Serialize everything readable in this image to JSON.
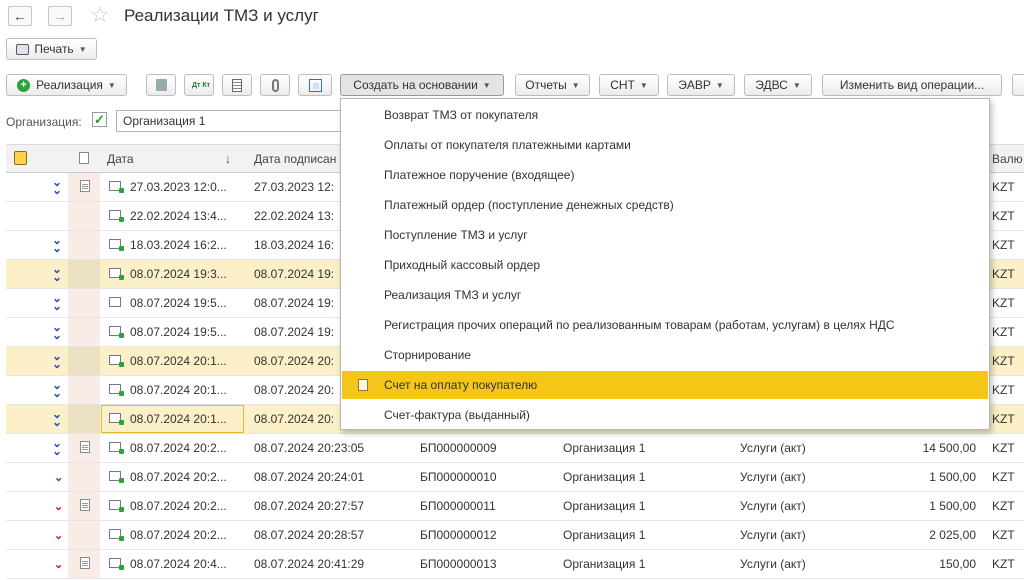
{
  "header": {
    "title": "Реализации ТМЗ и услуг",
    "back_icon": "←",
    "forward_icon": "→",
    "star_icon": "☆"
  },
  "toolbar1": {
    "print_label": "Печать"
  },
  "toolbar2": {
    "realization_label": "Реализация",
    "dt_kt_label": "Дт Кт",
    "create_based_label": "Создать на основании",
    "reports_label": "Отчеты",
    "snt_label": "СНТ",
    "eavr_label": "ЭАВР",
    "edvs_label": "ЭДВС",
    "change_op_label": "Изменить вид операции..."
  },
  "filter": {
    "org_label": "Организация:",
    "org_value": "Организация 1",
    "checked": "✓"
  },
  "table": {
    "columns": {
      "date": "Дата",
      "sort_arrow": "↓",
      "sign_date": "Дата подписан",
      "currency": "Валю"
    },
    "rows": [
      {
        "mark": "dbl",
        "doc": true,
        "date": "27.03.2023 12:0...",
        "sign": "27.03.2023 12:",
        "num": "",
        "org": "",
        "op": "",
        "sum": "",
        "cur": "KZT",
        "hl": false,
        "ico": "g"
      },
      {
        "mark": "",
        "doc": false,
        "date": "22.02.2024 13:4...",
        "sign": "22.02.2024 13:",
        "num": "",
        "org": "",
        "op": "",
        "sum": "",
        "cur": "KZT",
        "hl": false,
        "ico": "g"
      },
      {
        "mark": "dbl",
        "doc": false,
        "date": "18.03.2024 16:2...",
        "sign": "18.03.2024 16:",
        "num": "",
        "org": "",
        "op": "",
        "sum": "",
        "cur": "KZT",
        "hl": false,
        "ico": "g"
      },
      {
        "mark": "dbl",
        "doc": false,
        "date": "08.07.2024 19:3...",
        "sign": "08.07.2024 19:",
        "num": "",
        "org": "",
        "op": "",
        "sum": "",
        "cur": "KZT",
        "hl": true,
        "ico": "g"
      },
      {
        "mark": "dbl",
        "doc": false,
        "date": "08.07.2024 19:5...",
        "sign": "08.07.2024 19:",
        "num": "",
        "org": "",
        "op": "",
        "sum": "",
        "cur": "KZT",
        "hl": false,
        "ico": "gray"
      },
      {
        "mark": "dbl",
        "doc": false,
        "date": "08.07.2024 19:5...",
        "sign": "08.07.2024 19:",
        "num": "",
        "org": "",
        "op": "",
        "sum": "",
        "cur": "KZT",
        "hl": false,
        "ico": "g"
      },
      {
        "mark": "dbl",
        "doc": false,
        "date": "08.07.2024 20:1...",
        "sign": "08.07.2024 20:",
        "num": "",
        "org": "",
        "op": "",
        "sum": "",
        "cur": "KZT",
        "hl": true,
        "ico": "g"
      },
      {
        "mark": "dbl",
        "doc": false,
        "date": "08.07.2024 20:1...",
        "sign": "08.07.2024 20:",
        "num": "",
        "org": "",
        "op": "",
        "sum": "",
        "cur": "KZT",
        "hl": false,
        "ico": "g"
      },
      {
        "mark": "dbl",
        "doc": false,
        "date": "08.07.2024 20:1...",
        "sign": "08.07.2024 20:",
        "num": "",
        "org": "",
        "op": "",
        "sum": "",
        "cur": "KZT",
        "hl": true,
        "ico": "g",
        "sel": true
      },
      {
        "mark": "dbl",
        "doc": true,
        "date": "08.07.2024 20:2...",
        "sign": "08.07.2024 20:23:05",
        "num": "БП000000009",
        "org": "Организация 1",
        "op": "Услуги (акт)",
        "sum": "14 500,00",
        "cur": "KZT",
        "hl": false,
        "ico": "g"
      },
      {
        "mark": "red",
        "doc": false,
        "date": "08.07.2024 20:2...",
        "sign": "08.07.2024 20:24:01",
        "num": "БП000000010",
        "org": "Организация 1",
        "op": "Услуги (акт)",
        "sum": "1 500,00",
        "cur": "KZT",
        "hl": false,
        "ico": "g"
      },
      {
        "mark": "red",
        "doc": true,
        "date": "08.07.2024 20:2...",
        "sign": "08.07.2024 20:27:57",
        "num": "БП000000011",
        "org": "Организация 1",
        "op": "Услуги (акт)",
        "sum": "1 500,00",
        "cur": "KZT",
        "hl": false,
        "ico": "g"
      },
      {
        "mark": "red",
        "doc": false,
        "date": "08.07.2024 20:2...",
        "sign": "08.07.2024 20:28:57",
        "num": "БП000000012",
        "org": "Организация 1",
        "op": "Услуги (акт)",
        "sum": "2 025,00",
        "cur": "KZT",
        "hl": false,
        "ico": "g"
      },
      {
        "mark": "red",
        "doc": true,
        "date": "08.07.2024 20:4...",
        "sign": "08.07.2024 20:41:29",
        "num": "БП000000013",
        "org": "Организация 1",
        "op": "Услуги (акт)",
        "sum": "150,00",
        "cur": "KZT",
        "hl": false,
        "ico": "g"
      }
    ]
  },
  "dropdown": {
    "items": [
      "Возврат ТМЗ от покупателя",
      "Оплаты от покупателя платежными картами",
      "Платежное поручение (входящее)",
      "Платежный ордер (поступление денежных средств)",
      "Поступление ТМЗ и услуг",
      "Приходный кассовый ордер",
      "Реализация ТМЗ и услуг",
      "Регистрация прочих операций по реализованным товарам (работам, услугам) в целях НДС",
      "Сторнирование",
      "Счет на оплату покупателю",
      "Счет-фактура (выданный)"
    ],
    "active_index": 9
  },
  "colors": {
    "highlight": "#f5c518",
    "row_highlight": "#fbf0c8",
    "blue_mark": "#2a4dbf",
    "red_mark": "#cc1a1a",
    "green": "#1b9e2e"
  }
}
